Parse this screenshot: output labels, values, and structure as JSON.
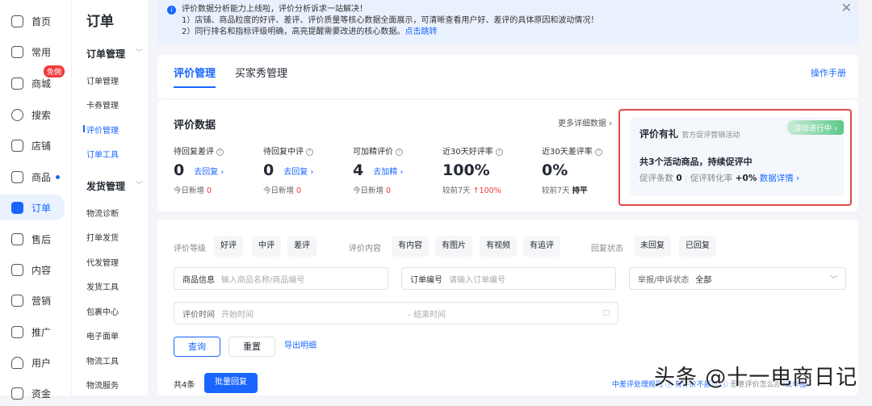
{
  "rail": [
    {
      "label": "首页"
    },
    {
      "label": "常用"
    },
    {
      "label": "商城",
      "badge": "免佣"
    },
    {
      "label": "搜索"
    },
    {
      "label": "店铺"
    },
    {
      "label": "商品"
    },
    {
      "label": "订单"
    },
    {
      "label": "售后"
    },
    {
      "label": "内容"
    },
    {
      "label": "营销"
    },
    {
      "label": "推广"
    },
    {
      "label": "用户"
    },
    {
      "label": "资金"
    }
  ],
  "subnav": {
    "title": "订单",
    "group1": "订单管理",
    "g1items": [
      "订单管理",
      "卡券管理",
      "评价管理",
      "订单工具"
    ],
    "group2": "发货管理",
    "g2items": [
      "物流诊断",
      "打单发货",
      "代发管理",
      "发货工具",
      "包裹中心",
      "电子面单",
      "物流工具",
      "物流服务"
    ]
  },
  "notice": {
    "line1": "评价数据分析能力上线啦，评价分析诉求一站解决！",
    "line2": "1）店铺、商品粒度的好评、差评、评价质量等核心数据全面展示，可清晰查看用户好、差评的具体原因和波动情况！",
    "line3": "2）同行排名和指标评级明确，高亮提醒需要改进的核心数据。",
    "link": "点击跳转",
    "close": "✕"
  },
  "tabs": {
    "items": [
      "评价管理",
      "买家秀管理"
    ],
    "manual": "操作手册"
  },
  "stats": {
    "title": "评价数据",
    "more": "更多详细数据 ›",
    "items": [
      {
        "label": "待回复差评",
        "value": "0",
        "action": "去回复 ›",
        "sub": "今日新增",
        "subval": "0"
      },
      {
        "label": "待回复中评",
        "value": "0",
        "action": "去回复 ›",
        "sub": "今日新增",
        "subval": "0"
      },
      {
        "label": "可加精评价",
        "value": "4",
        "action": "去加精 ›",
        "sub": "今日新增",
        "subval": "0"
      },
      {
        "label": "近30天好评率",
        "value": "100%",
        "action": "",
        "sub": "较前7天",
        "subval": "↑100%"
      },
      {
        "label": "近30天差评率",
        "value": "0%",
        "action": "",
        "sub": "较前7天",
        "subval": "持平"
      }
    ]
  },
  "promo": {
    "title": "评价有礼",
    "subtitle": "官方促评营销活动",
    "tag": "活动进行中 ›",
    "headline": "共3个活动商品，持续促评中",
    "count_label": "促评条数",
    "count": "0",
    "rate_label": "促评转化率",
    "rate": "+0%",
    "detail": "数据详情 ›"
  },
  "filters": {
    "level_label": "评价等级",
    "levels": [
      "好评",
      "中评",
      "差评"
    ],
    "content_label": "评价内容",
    "contents": [
      "有内容",
      "有图片",
      "有视频",
      "有追评"
    ],
    "reply_label": "回复状态",
    "replies": [
      "未回复",
      "已回复"
    ],
    "product_label": "商品信息",
    "product_ph": "输入商品名称/商品编号",
    "order_label": "订单编号",
    "order_ph": "请输入订单编号",
    "report_label": "举报/申诉状态",
    "report_value": "全部",
    "time_label": "评价时间",
    "start_ph": "开始时间",
    "end_ph": "– 结束时间",
    "query": "查询",
    "reset": "重置",
    "export": "导出明细"
  },
  "list": {
    "total": "共4条",
    "batch": "批量回复",
    "rule1": "中差评处理规则 ⓘ",
    "rule2": "有评价不展示 ⓘ",
    "rule3": "恶意评价怎么办?",
    "report": "去举报 ›"
  },
  "watermark": "头条 @十一电商日记"
}
